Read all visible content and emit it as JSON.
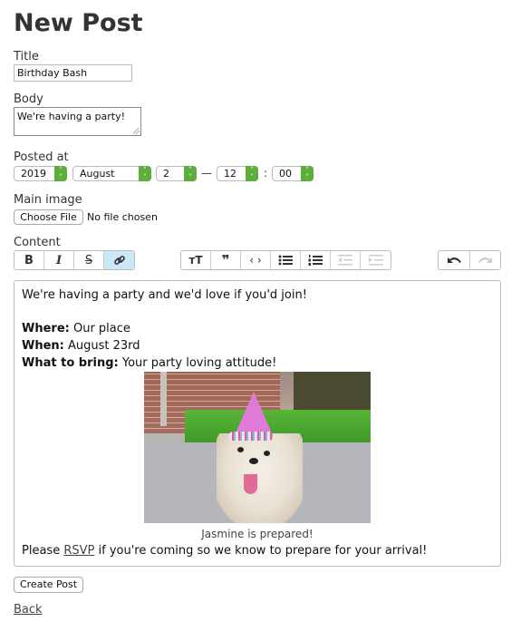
{
  "page": {
    "title": "New Post"
  },
  "form": {
    "title_label": "Title",
    "title_value": "Birthday Bash",
    "body_label": "Body",
    "body_value": "We're having a party!",
    "posted_at_label": "Posted at",
    "posted_at": {
      "year": "2019",
      "month": "August",
      "day": "2",
      "dash": "—",
      "hour": "12",
      "colon": ":",
      "minute": "00"
    },
    "main_image_label": "Main image",
    "choose_file_label": "Choose File",
    "no_file_text": "No file chosen",
    "content_label": "Content"
  },
  "toolbar": {
    "text_group": [
      {
        "name": "bold",
        "glyph": "B",
        "active": false
      },
      {
        "name": "italic",
        "glyph": "I",
        "active": false
      },
      {
        "name": "strikethrough",
        "glyph": "S",
        "active": false
      },
      {
        "name": "link",
        "glyph": "🔗",
        "active": true
      }
    ],
    "block_group": [
      {
        "name": "heading",
        "glyph": "тT"
      },
      {
        "name": "quote",
        "glyph": "❞"
      },
      {
        "name": "code",
        "glyph": "‹›"
      },
      {
        "name": "bullet-list",
        "glyph": "☰"
      },
      {
        "name": "numbered-list",
        "glyph": "☰"
      },
      {
        "name": "decrease-indent",
        "glyph": "⇤",
        "disabled": true
      },
      {
        "name": "increase-indent",
        "glyph": "⇥",
        "disabled": true
      }
    ],
    "history_group": [
      {
        "name": "undo",
        "glyph": "↶"
      },
      {
        "name": "redo",
        "glyph": "↷",
        "disabled": true
      }
    ]
  },
  "content": {
    "intro": "We're having a party and we'd love if you'd join!",
    "where_label": "Where:",
    "where_value": " Our place",
    "when_label": "When:",
    "when_value": " August 23rd",
    "bring_label": "What to bring:",
    "bring_value": " Your party loving attitude!",
    "image_alt": "dog wearing a party hat",
    "caption": "Jasmine is prepared!",
    "rsvp_before": "Please ",
    "rsvp_link": "RSVP",
    "rsvp_after": " if you're coming so we know to prepare for your arrival!"
  },
  "actions": {
    "create_label": "Create Post",
    "back_label": "Back"
  }
}
